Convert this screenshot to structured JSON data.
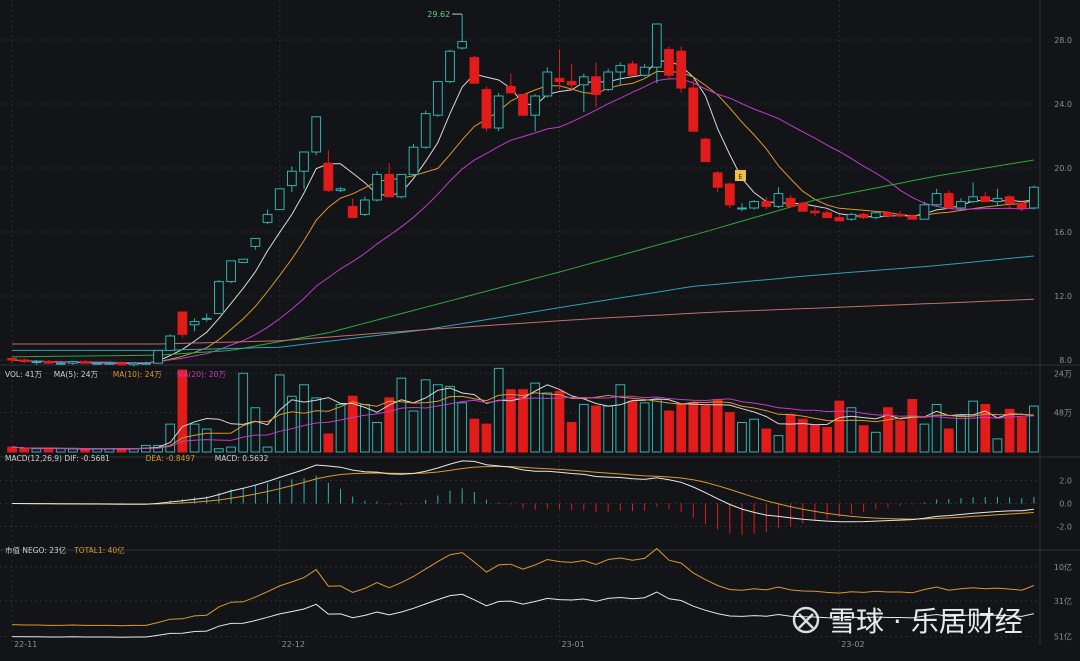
{
  "colors": {
    "background": "#131417",
    "grid": "#2a2d33",
    "axis_text": "#8a8f98",
    "up": "#2fb3b0",
    "down": "#e21b1b",
    "ma5": "#d8d8d8",
    "ma10": "#d99a2b",
    "ma20": "#c13cc9",
    "ma60": "#2ea83a",
    "ma120": "#2aa3b8",
    "ma250": "#c07070",
    "dea": "#d99a2b",
    "dif": "#e8e8e8",
    "nego": "#e8e8e8",
    "total": "#d99a2b",
    "marker": "#e8c248"
  },
  "price_panel": {
    "yticks": [
      "8.0",
      "12.0",
      "16.0",
      "20.0",
      "24.0",
      "28.0"
    ],
    "high_label": "29.62",
    "marker_label": "E"
  },
  "volume_panel": {
    "legend": [
      {
        "text": "VOL: 41万",
        "color": "#d0d0d0"
      },
      {
        "text": "MA(5): 24万",
        "color": "#d0d0d0"
      },
      {
        "text": "MA(10): 24万",
        "color": "#d99a2b"
      },
      {
        "text": "MA(20): 20万",
        "color": "#c13cc9"
      }
    ],
    "yticks": [
      "48万",
      "24万"
    ]
  },
  "macd_panel": {
    "legend": [
      {
        "text": "MACD(12,26,9) DIF: -0.5681",
        "color": "#d0d0d0"
      },
      {
        "text": "DEA: -0.8497",
        "color": "#d99a2b"
      },
      {
        "text": "MACD: 0.5632",
        "color": "#d0d0d0"
      }
    ],
    "yticks": [
      "2.0",
      "0.0",
      "-2.0"
    ]
  },
  "cap_panel": {
    "legend": [
      {
        "text": "市值 NEGO: 23亿",
        "color": "#d0d0d0"
      },
      {
        "text": "TOTAL1: 40亿",
        "color": "#d99a2b"
      }
    ],
    "yticks": [
      "51亿",
      "31亿",
      "10亿"
    ]
  },
  "date_labels": [
    "22-11",
    "22-12",
    "23-01",
    "23-02"
  ],
  "watermark": {
    "text": "雪球 · 乐居财经"
  },
  "chart_data": [
    {
      "type": "candlestick",
      "ylim": [
        8,
        30
      ],
      "yticks": [
        8,
        12,
        16,
        20,
        24,
        28
      ],
      "x_labels": [
        "22-11",
        "22-12",
        "23-01",
        "23-02"
      ],
      "high": {
        "value": 29.62,
        "index": 37
      },
      "ohlc": [
        [
          8.1,
          8.2,
          7.8,
          8.0
        ],
        [
          8.0,
          8.1,
          7.8,
          7.9
        ],
        [
          7.9,
          8.0,
          7.7,
          7.9
        ],
        [
          7.9,
          8.0,
          7.8,
          7.8
        ],
        [
          7.8,
          7.9,
          7.7,
          7.8
        ],
        [
          7.8,
          7.9,
          7.7,
          7.9
        ],
        [
          7.9,
          8.0,
          7.8,
          7.8
        ],
        [
          7.8,
          7.9,
          7.7,
          7.8
        ],
        [
          7.8,
          7.9,
          7.7,
          7.8
        ],
        [
          7.8,
          7.9,
          7.7,
          7.7
        ],
        [
          7.7,
          7.8,
          7.6,
          7.8
        ],
        [
          7.8,
          7.9,
          7.7,
          7.8
        ],
        [
          7.8,
          8.6,
          7.8,
          8.6
        ],
        [
          8.6,
          9.6,
          8.6,
          9.5
        ],
        [
          11.0,
          11.0,
          9.4,
          9.6
        ],
        [
          10.2,
          10.6,
          9.8,
          10.4
        ],
        [
          10.6,
          10.9,
          10.4,
          10.6
        ],
        [
          10.9,
          13.0,
          10.9,
          12.9
        ],
        [
          12.9,
          14.2,
          12.8,
          14.2
        ],
        [
          14.1,
          14.3,
          14.1,
          14.3
        ],
        [
          15.1,
          15.6,
          14.9,
          15.6
        ],
        [
          16.6,
          17.4,
          16.5,
          17.1
        ],
        [
          17.4,
          18.7,
          17.4,
          18.7
        ],
        [
          18.9,
          20.1,
          18.5,
          19.8
        ],
        [
          19.8,
          21.0,
          18.7,
          21.0
        ],
        [
          21.0,
          23.2,
          20.8,
          23.2
        ],
        [
          20.3,
          21.1,
          18.5,
          18.6
        ],
        [
          18.6,
          18.8,
          18.5,
          18.7
        ],
        [
          17.6,
          18.1,
          16.9,
          16.9
        ],
        [
          17.1,
          18.2,
          17.0,
          18.0
        ],
        [
          18.0,
          19.8,
          17.9,
          19.6
        ],
        [
          19.6,
          20.3,
          18.6,
          18.2
        ],
        [
          18.2,
          19.5,
          18.1,
          19.6
        ],
        [
          19.6,
          21.5,
          19.5,
          21.3
        ],
        [
          21.3,
          23.6,
          21.2,
          23.4
        ],
        [
          23.3,
          25.4,
          23.2,
          25.4
        ],
        [
          25.4,
          27.4,
          25.3,
          27.3
        ],
        [
          27.5,
          29.6,
          27.4,
          27.9
        ],
        [
          26.9,
          27.0,
          25.4,
          25.3
        ],
        [
          24.9,
          25.1,
          22.3,
          22.5
        ],
        [
          22.5,
          24.7,
          22.3,
          24.5
        ],
        [
          25.1,
          25.9,
          24.7,
          24.7
        ],
        [
          24.6,
          24.6,
          23.4,
          23.3
        ],
        [
          23.3,
          24.6,
          22.3,
          24.5
        ],
        [
          24.5,
          26.3,
          24.4,
          26.0
        ],
        [
          25.6,
          27.4,
          24.9,
          25.4
        ],
        [
          25.4,
          26.5,
          24.9,
          25.2
        ],
        [
          25.2,
          25.9,
          23.5,
          25.7
        ],
        [
          25.7,
          26.6,
          23.8,
          24.6
        ],
        [
          24.9,
          26.2,
          24.8,
          26.0
        ],
        [
          26.0,
          26.6,
          25.2,
          26.4
        ],
        [
          26.5,
          26.7,
          25.8,
          25.8
        ],
        [
          25.8,
          26.5,
          25.7,
          26.3
        ],
        [
          26.3,
          29.0,
          25.3,
          29.0
        ],
        [
          27.4,
          27.6,
          25.5,
          25.8
        ],
        [
          27.3,
          27.6,
          24.7,
          25.0
        ],
        [
          25.0,
          25.5,
          23.4,
          22.3
        ],
        [
          21.8,
          21.9,
          20.4,
          20.4
        ],
        [
          19.7,
          19.8,
          18.5,
          18.8
        ],
        [
          19.0,
          19.1,
          17.5,
          17.7
        ],
        [
          17.5,
          17.8,
          17.3,
          17.5
        ],
        [
          17.5,
          18.0,
          17.4,
          17.9
        ],
        [
          17.9,
          18.2,
          17.4,
          17.6
        ],
        [
          17.6,
          18.8,
          17.5,
          18.4
        ],
        [
          18.1,
          18.3,
          17.6,
          17.6
        ],
        [
          17.8,
          17.9,
          17.3,
          17.3
        ],
        [
          17.3,
          17.6,
          17.0,
          17.2
        ],
        [
          17.2,
          17.4,
          16.9,
          16.9
        ],
        [
          16.9,
          17.1,
          16.8,
          16.7
        ],
        [
          16.8,
          17.2,
          16.7,
          17.1
        ],
        [
          17.1,
          17.2,
          16.8,
          16.9
        ],
        [
          16.9,
          17.3,
          16.8,
          17.2
        ],
        [
          17.2,
          17.3,
          16.9,
          17.0
        ],
        [
          17.1,
          17.3,
          16.9,
          17.0
        ],
        [
          17.0,
          17.1,
          16.8,
          16.8
        ],
        [
          16.8,
          17.9,
          16.8,
          17.7
        ],
        [
          17.7,
          18.7,
          17.6,
          18.4
        ],
        [
          18.4,
          18.6,
          17.6,
          17.5
        ],
        [
          17.5,
          18.1,
          17.4,
          17.9
        ],
        [
          17.9,
          19.1,
          17.8,
          18.2
        ],
        [
          18.2,
          18.5,
          17.9,
          17.9
        ],
        [
          17.9,
          18.7,
          17.6,
          18.1
        ],
        [
          18.2,
          18.3,
          17.4,
          17.8
        ],
        [
          17.8,
          18.0,
          17.3,
          17.5
        ],
        [
          17.5,
          18.9,
          17.4,
          18.8
        ]
      ],
      "series": [
        {
          "name": "MA(5)"
        },
        {
          "name": "MA(10)"
        },
        {
          "name": "MA(20)"
        },
        {
          "x": [
            0,
            12,
            18,
            26,
            34,
            45,
            56,
            66,
            76,
            84
          ],
          "values": [
            8.2,
            8.3,
            8.6,
            9.7,
            11.3,
            13.5,
            15.8,
            18.0,
            19.5,
            20.5
          ]
        },
        {
          "x": [
            0,
            12,
            22,
            34,
            46,
            56,
            66,
            76,
            84
          ],
          "values": [
            8.6,
            8.6,
            8.8,
            9.9,
            11.4,
            12.6,
            13.3,
            13.9,
            14.5
          ]
        },
        {
          "x": [
            0,
            12,
            22,
            34,
            48,
            58,
            68,
            78,
            84
          ],
          "values": [
            9.0,
            9.0,
            9.2,
            9.9,
            10.6,
            11.0,
            11.3,
            11.6,
            11.8
          ]
        }
      ]
    },
    {
      "type": "bar",
      "ylim": [
        0,
        50
      ],
      "yticks": [
        24,
        48
      ],
      "values": [
        3,
        2,
        2,
        2,
        2,
        2,
        2,
        2,
        2,
        2,
        2,
        4,
        4,
        17,
        50,
        17,
        14,
        2,
        3,
        48,
        27,
        3,
        47,
        34,
        41,
        33,
        11,
        29,
        34,
        29,
        18,
        33,
        45,
        25,
        44,
        41,
        40,
        30,
        20,
        17,
        51,
        38,
        38,
        42,
        36,
        37,
        18,
        29,
        28,
        28,
        41,
        31,
        30,
        32,
        25,
        29,
        30,
        28,
        32,
        24,
        18,
        20,
        14,
        10,
        23,
        20,
        16,
        15,
        31,
        27,
        16,
        12,
        27,
        19,
        32,
        17,
        29,
        14,
        22,
        31,
        29,
        8,
        26,
        21,
        28,
        18,
        13,
        29,
        30,
        31,
        19,
        24,
        22,
        17,
        20,
        28,
        26,
        41
      ],
      "series": [
        {
          "name": "MA(5)"
        },
        {
          "name": "MA(10)"
        },
        {
          "name": "MA(20)"
        }
      ]
    },
    {
      "type": "bar",
      "ylim": [
        -3.6,
        3.6
      ],
      "yticks": [
        2.0,
        0.0,
        -2.0
      ],
      "series": [
        {
          "name": "DIF"
        },
        {
          "name": "DEA"
        },
        {
          "name": "MACD"
        }
      ]
    },
    {
      "type": "line",
      "ylim": [
        8,
        58
      ],
      "yticks": [
        10,
        31,
        51
      ],
      "series": [
        {
          "name": "NEGO"
        },
        {
          "name": "TOTAL1"
        }
      ]
    }
  ]
}
